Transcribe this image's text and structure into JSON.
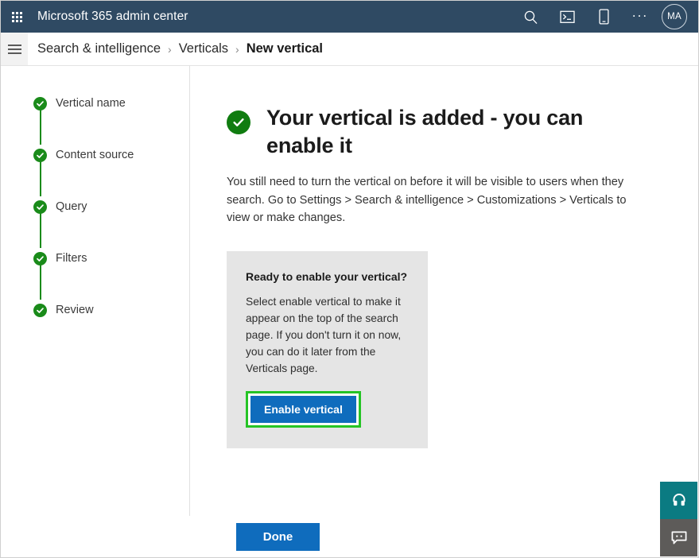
{
  "suitebar": {
    "app_title": "Microsoft 365 admin center",
    "waffle_label": "app-launcher",
    "actions": [
      {
        "name": "search-icon",
        "label": "Search"
      },
      {
        "name": "console-icon",
        "label": "Open console"
      },
      {
        "name": "mobile-icon",
        "label": "Mobile"
      },
      {
        "name": "more-icon",
        "label": "..."
      }
    ],
    "avatar_initials": "MA"
  },
  "breadcrumb": {
    "separator": "›",
    "items": [
      {
        "label": "Search & intelligence",
        "current": false
      },
      {
        "label": "Verticals",
        "current": false
      },
      {
        "label": "New vertical",
        "current": true
      }
    ]
  },
  "wizard": {
    "steps": [
      {
        "label": "Vertical name",
        "state": "complete"
      },
      {
        "label": "Content source",
        "state": "complete"
      },
      {
        "label": "Query",
        "state": "complete"
      },
      {
        "label": "Filters",
        "state": "complete"
      },
      {
        "label": "Review",
        "state": "complete"
      }
    ]
  },
  "main": {
    "headline": "Your vertical is added - you can enable it",
    "intro": "You still need to turn the vertical on before it will be visible to users when they search. Go to Settings > Search & intelligence > Customizations > Verticals to view or make changes.",
    "callout": {
      "title": "Ready to enable your vertical?",
      "body": "Select enable vertical to make it appear on the top of the search page. If you don't turn it on now, you can do it later from the Verticals page.",
      "button_label": "Enable vertical"
    }
  },
  "footer": {
    "done_label": "Done"
  },
  "widgets": [
    {
      "name": "support-headset-icon",
      "label": "Support"
    },
    {
      "name": "feedback-chat-icon",
      "label": "Feedback"
    }
  ],
  "colors": {
    "suitebar_bg": "#2f4a63",
    "accent_blue": "#0f6cbd",
    "success_green": "#107c10",
    "step_green": "#1a8b1a",
    "highlight_green": "#25c425",
    "callout_bg": "#e5e5e5",
    "support_teal": "#0b7b82",
    "feedback_gray": "#5d5b59"
  }
}
